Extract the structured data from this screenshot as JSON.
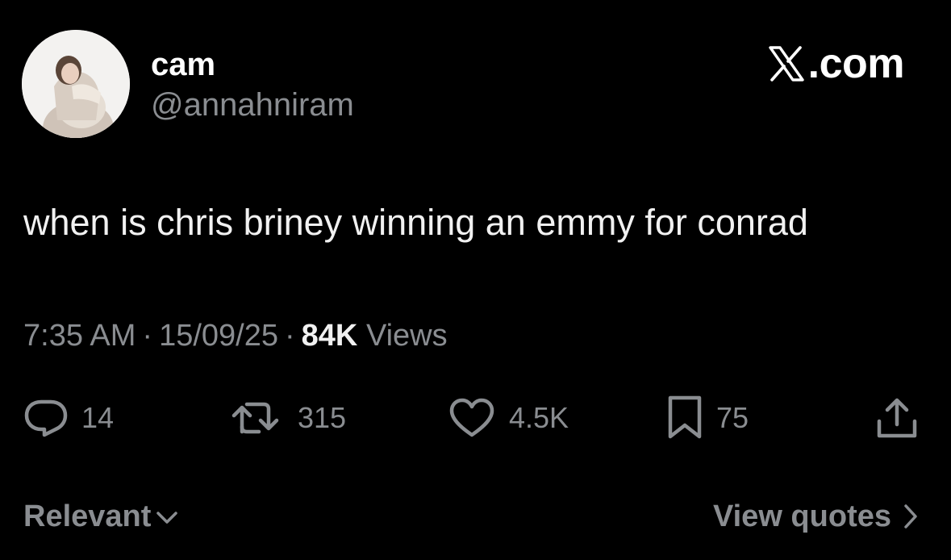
{
  "author": {
    "display_name": "cam",
    "handle": "@annahniram",
    "avatar_icon": "profile-photo"
  },
  "brand": {
    "label": ".com",
    "logo_icon": "x-logo-icon"
  },
  "tweet": {
    "text": "when is chris briney winning an emmy for conrad"
  },
  "meta": {
    "time": "7:35 AM",
    "date": "15/09/25",
    "separator": "·",
    "views_count": "84K",
    "views_label": "Views"
  },
  "actions": {
    "replies": {
      "icon": "reply-icon",
      "count": "14"
    },
    "reposts": {
      "icon": "repost-icon",
      "count": "315"
    },
    "likes": {
      "icon": "heart-icon",
      "count": "4.5K"
    },
    "bookmarks": {
      "icon": "bookmark-icon",
      "count": "75"
    },
    "share": {
      "icon": "share-icon"
    }
  },
  "footer": {
    "sort_label": "Relevant",
    "sort_icon": "chevron-down-icon",
    "quotes_label": "View quotes",
    "quotes_icon": "chevron-right-icon"
  },
  "colors": {
    "background": "#000000",
    "primary_text": "#ffffff",
    "secondary_text": "#8a8d91"
  }
}
